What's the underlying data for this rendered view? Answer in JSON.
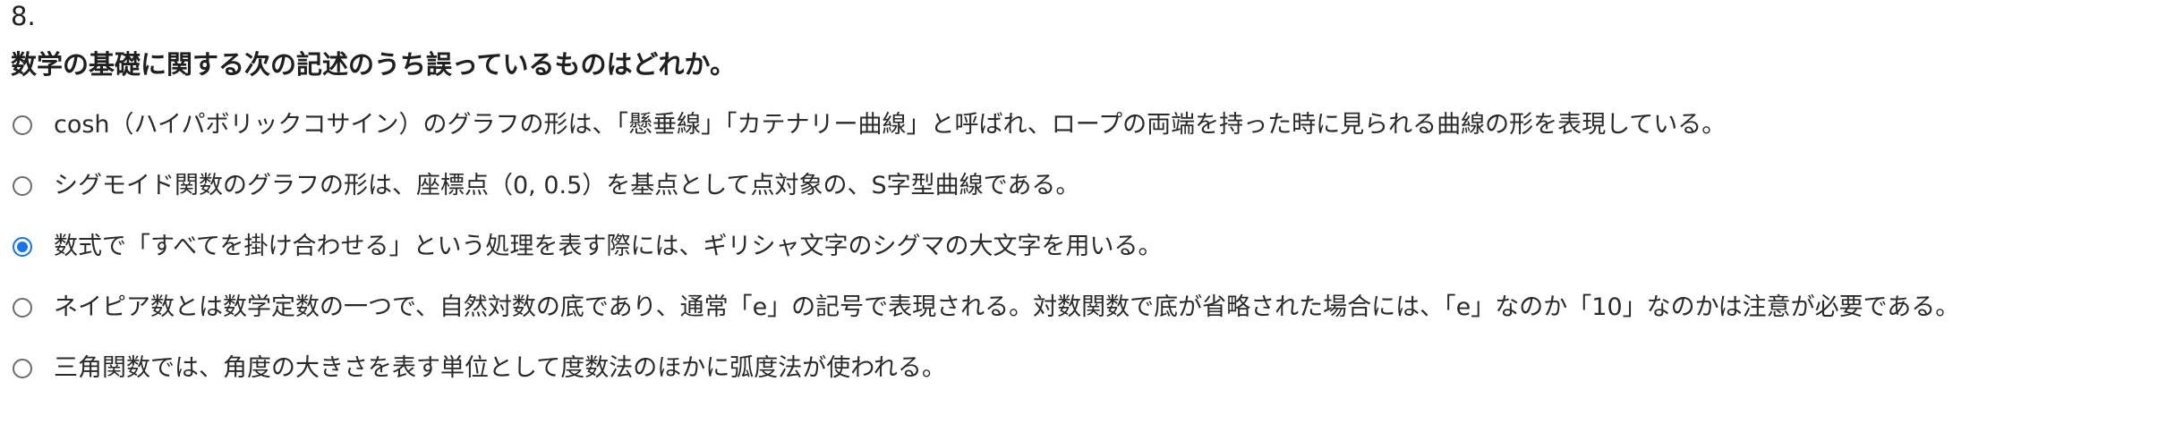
{
  "question": {
    "number": "8.",
    "text": "数学の基礎に関する次の記述のうち誤っているものはどれか。"
  },
  "options": [
    {
      "label": "cosh（ハイパボリックコサイン）のグラフの形は、「懸垂線」「カテナリー曲線」と呼ばれ、ロープの両端を持った時に見られる曲線の形を表現している。",
      "selected": false
    },
    {
      "label": "シグモイド関数のグラフの形は、座標点（0, 0.5）を基点として点対象の、S字型曲線である。",
      "selected": false
    },
    {
      "label": "数式で「すべてを掛け合わせる」という処理を表す際には、ギリシャ文字のシグマの大文字を用いる。",
      "selected": true
    },
    {
      "label": "ネイピア数とは数学定数の一つで、自然対数の底であり、通常「e」の記号で表現される。対数関数で底が省略された場合には、「e」なのか「10」なのかは注意が必要である。",
      "selected": false
    },
    {
      "label": "三角関数では、角度の大きさを表す単位として度数法のほかに弧度法が使われる。",
      "selected": false
    }
  ],
  "colors": {
    "radio_selected": "#1a73e8",
    "radio_border": "#6b6b6b"
  }
}
